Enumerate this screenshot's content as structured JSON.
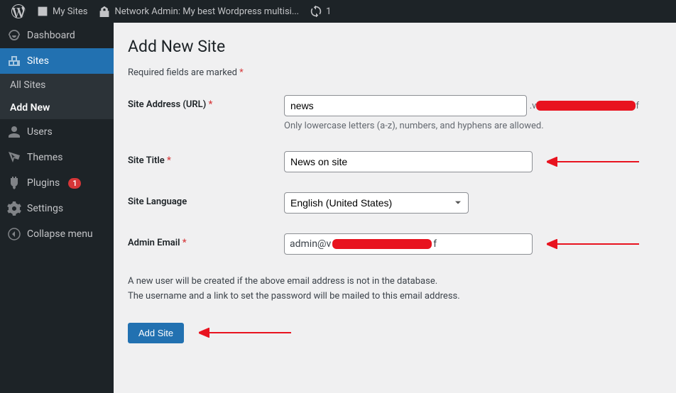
{
  "adminbar": {
    "my_sites": "My Sites",
    "network_admin": "Network Admin: My best Wordpress multisi...",
    "updates_count": "1"
  },
  "sidebar": {
    "dashboard": "Dashboard",
    "sites": "Sites",
    "all_sites": "All Sites",
    "add_new": "Add New",
    "users": "Users",
    "themes": "Themes",
    "plugins": "Plugins",
    "plugins_badge": "1",
    "settings": "Settings",
    "collapse": "Collapse menu"
  },
  "page": {
    "title": "Add New Site",
    "required_note": "Required fields are marked ",
    "asterisk": "*"
  },
  "form": {
    "address_label": "Site Address (URL) ",
    "address_value": "news",
    "address_suffix_pre": ".v",
    "address_suffix_post": "f",
    "address_help": "Only lowercase letters (a-z), numbers, and hyphens are allowed.",
    "title_label": "Site Title ",
    "title_value": "News on site",
    "lang_label": "Site Language",
    "lang_value": "English (United States)",
    "email_label": "Admin Email ",
    "email_pre": "admin@v",
    "email_post": "f",
    "info_line1": "A new user will be created if the above email address is not in the database.",
    "info_line2": "The username and a link to set the password will be mailed to this email address.",
    "submit": "Add Site"
  }
}
